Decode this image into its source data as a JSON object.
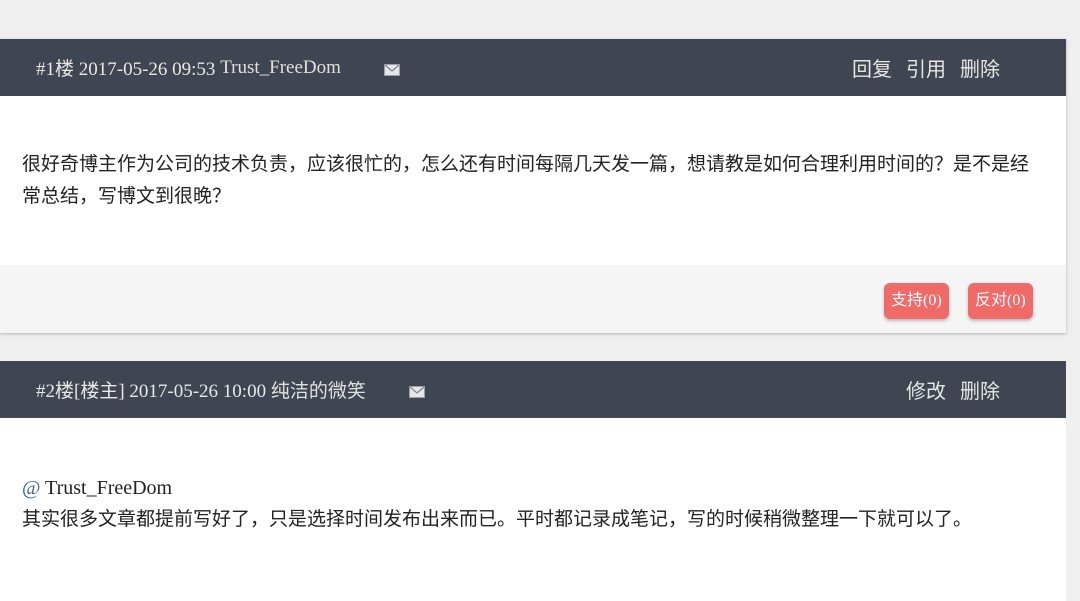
{
  "comments": [
    {
      "meta": "#1楼 2017-05-26 09:53 ",
      "author": "Trust_FreeDom",
      "actions": [
        "回复",
        "引用",
        "删除"
      ],
      "body": "很好奇博主作为公司的技术负责，应该很忙的，怎么还有时间每隔几天发一篇，想请教是如何合理利用时间的？是不是经常总结，写博文到很晚？",
      "support": "支持(0)",
      "oppose": "反对(0)"
    },
    {
      "meta": "#2楼[楼主] 2017-05-26 10:00 ",
      "author": "纯洁的微笑",
      "actions": [
        "修改",
        "删除"
      ],
      "mention_at": "@",
      "mention_name": " Trust_FreeDom",
      "body": "其实很多文章都提前写好了，只是选择时间发布出来而已。平时都记录成笔记，写的时候稍微整理一下就可以了。"
    }
  ],
  "icons": {
    "mail": "mail-icon"
  }
}
